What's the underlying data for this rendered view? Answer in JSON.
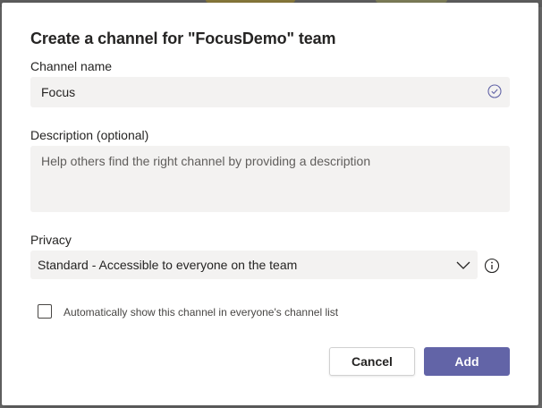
{
  "dialog": {
    "title": "Create a channel for \"FocusDemo\" team",
    "channel_name": {
      "label": "Channel name",
      "value": "Focus"
    },
    "description": {
      "label": "Description (optional)",
      "placeholder": "Help others find the right channel by providing a description"
    },
    "privacy": {
      "label": "Privacy",
      "selected": "Standard - Accessible to everyone on the team"
    },
    "auto_show": {
      "label": "Automatically show this channel in everyone's channel list",
      "checked": false
    },
    "buttons": {
      "cancel": "Cancel",
      "add": "Add"
    }
  },
  "colors": {
    "accent": "#6264a7",
    "field_bg": "#f3f2f1"
  },
  "icons": {
    "valid": "check-circle-icon",
    "dropdown": "chevron-down-icon",
    "info": "info-icon"
  }
}
